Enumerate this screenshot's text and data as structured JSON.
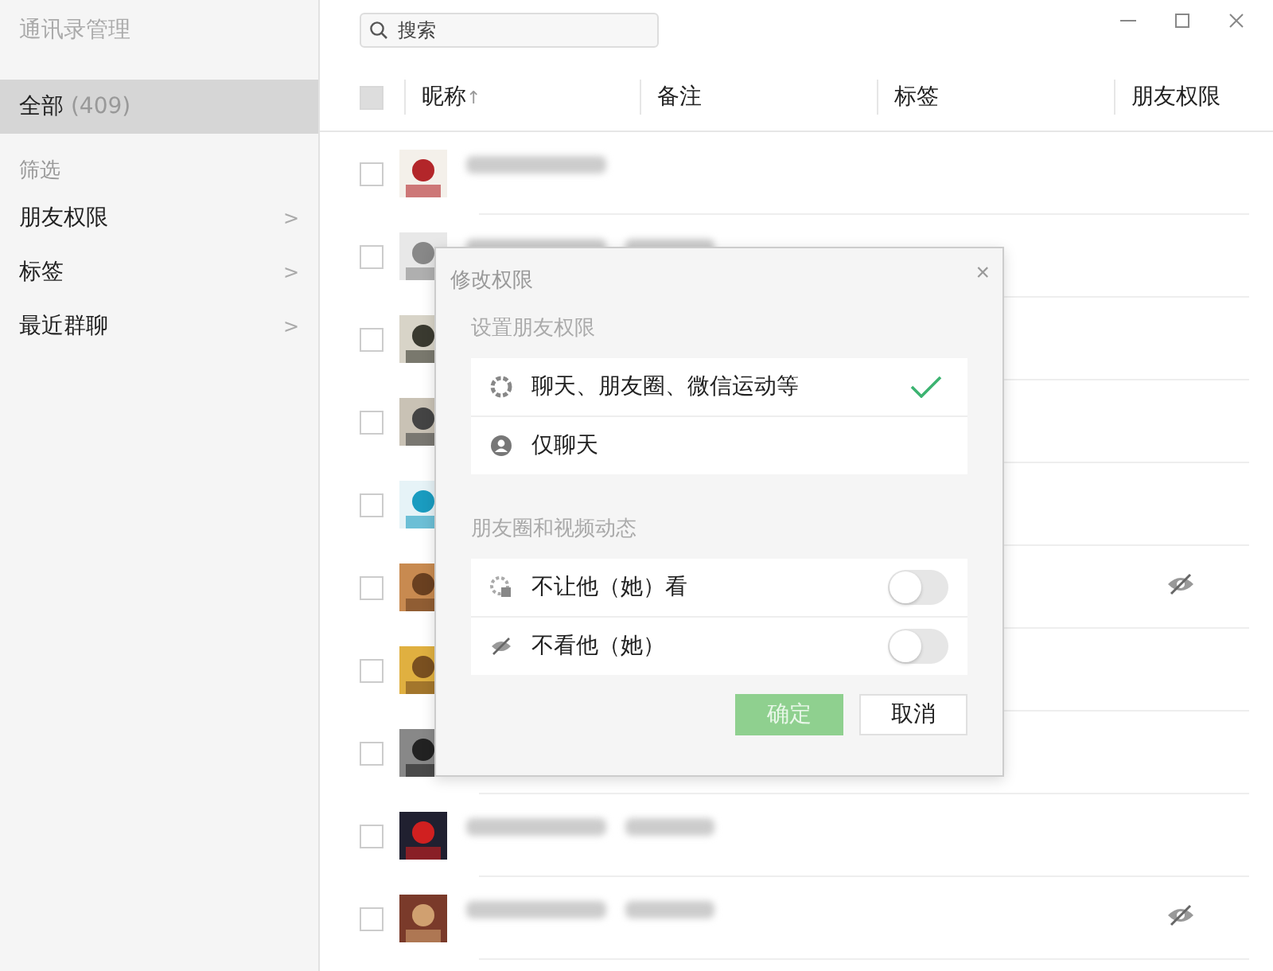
{
  "sidebar": {
    "title": "通讯录管理",
    "all": {
      "label": "全部",
      "count": "(409)",
      "selected": true
    },
    "filter_heading": "筛选",
    "items": [
      {
        "label": "朋友权限",
        "arrow": ">"
      },
      {
        "label": "标签",
        "arrow": ">"
      },
      {
        "label": "最近群聊",
        "arrow": ">"
      }
    ]
  },
  "search": {
    "placeholder": "搜索"
  },
  "table": {
    "select_all": {
      "checked": false,
      "disabled": true
    },
    "columns": [
      {
        "label": "昵称",
        "sort": "↑"
      },
      {
        "label": "备注"
      },
      {
        "label": "标签"
      },
      {
        "label": "朋友权限"
      }
    ],
    "rows": [
      {
        "checked": false,
        "name_blurred": true,
        "remark_blurred": false,
        "moments_hidden": false
      },
      {
        "checked": false,
        "name_blurred": true,
        "remark_blurred": true,
        "moments_hidden": false
      },
      {
        "checked": false,
        "name_blurred": false,
        "remark_blurred": false,
        "moments_hidden": false
      },
      {
        "checked": false,
        "name_blurred": false,
        "remark_blurred": false,
        "moments_hidden": false
      },
      {
        "checked": false,
        "name_blurred": false,
        "remark_blurred": false,
        "moments_hidden": false
      },
      {
        "checked": false,
        "name_blurred": false,
        "remark_blurred": false,
        "moments_hidden": true
      },
      {
        "checked": false,
        "name_blurred": false,
        "remark_blurred": false,
        "moments_hidden": false
      },
      {
        "checked": false,
        "name_blurred": false,
        "remark_blurred": false,
        "moments_hidden": false
      },
      {
        "checked": false,
        "name_blurred": true,
        "remark_blurred": true,
        "moments_hidden": false
      },
      {
        "checked": false,
        "name_blurred": true,
        "remark_blurred": true,
        "moments_hidden": true
      }
    ]
  },
  "dialog": {
    "title": "修改权限",
    "close": "×",
    "permission_heading": "设置朋友权限",
    "permissions": [
      {
        "kind": "all",
        "label": "聊天、朋友圈、微信运动等",
        "selected": true
      },
      {
        "kind": "chat",
        "label": "仅聊天",
        "selected": false
      }
    ],
    "moments_heading": "朋友圈和视频动态",
    "toggles": [
      {
        "kind": "lock",
        "label": "不让他（她）看",
        "on": false
      },
      {
        "kind": "eye",
        "label": "不看他（她）",
        "on": false
      }
    ],
    "buttons": [
      {
        "kind": "primary",
        "label": "确定",
        "disabled": true
      },
      {
        "kind": "secondary",
        "label": "取消",
        "disabled": false
      }
    ]
  }
}
